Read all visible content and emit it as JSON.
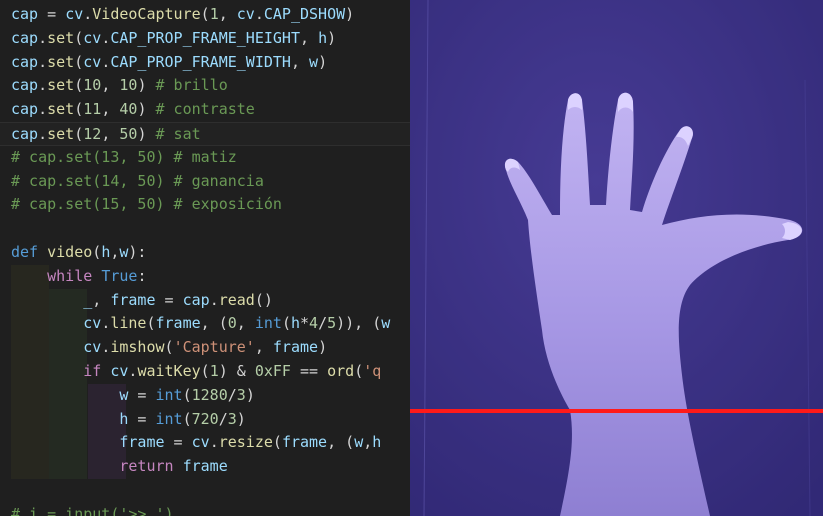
{
  "editor": {
    "lines": [
      [
        {
          "t": "cap",
          "c": "v"
        },
        {
          "t": " = ",
          "c": "p"
        },
        {
          "t": "cv",
          "c": "v"
        },
        {
          "t": ".",
          "c": "p"
        },
        {
          "t": "VideoCapture",
          "c": "f"
        },
        {
          "t": "(",
          "c": "p"
        },
        {
          "t": "1",
          "c": "n"
        },
        {
          "t": ", ",
          "c": "p"
        },
        {
          "t": "cv",
          "c": "v"
        },
        {
          "t": ".",
          "c": "p"
        },
        {
          "t": "CAP_DSHOW",
          "c": "v"
        },
        {
          "t": ")",
          "c": "p"
        }
      ],
      [
        {
          "t": "cap",
          "c": "v"
        },
        {
          "t": ".",
          "c": "p"
        },
        {
          "t": "set",
          "c": "f"
        },
        {
          "t": "(",
          "c": "p"
        },
        {
          "t": "cv",
          "c": "v"
        },
        {
          "t": ".",
          "c": "p"
        },
        {
          "t": "CAP_PROP_FRAME_HEIGHT",
          "c": "v"
        },
        {
          "t": ", ",
          "c": "p"
        },
        {
          "t": "h",
          "c": "v"
        },
        {
          "t": ")",
          "c": "p"
        }
      ],
      [
        {
          "t": "cap",
          "c": "v"
        },
        {
          "t": ".",
          "c": "p"
        },
        {
          "t": "set",
          "c": "f"
        },
        {
          "t": "(",
          "c": "p"
        },
        {
          "t": "cv",
          "c": "v"
        },
        {
          "t": ".",
          "c": "p"
        },
        {
          "t": "CAP_PROP_FRAME_WIDTH",
          "c": "v"
        },
        {
          "t": ", ",
          "c": "p"
        },
        {
          "t": "w",
          "c": "v"
        },
        {
          "t": ")",
          "c": "p"
        }
      ],
      [
        {
          "t": "cap",
          "c": "v"
        },
        {
          "t": ".",
          "c": "p"
        },
        {
          "t": "set",
          "c": "f"
        },
        {
          "t": "(",
          "c": "p"
        },
        {
          "t": "10",
          "c": "n"
        },
        {
          "t": ", ",
          "c": "p"
        },
        {
          "t": "10",
          "c": "n"
        },
        {
          "t": ") ",
          "c": "p"
        },
        {
          "t": "# brillo",
          "c": "c"
        }
      ],
      [
        {
          "t": "cap",
          "c": "v"
        },
        {
          "t": ".",
          "c": "p"
        },
        {
          "t": "set",
          "c": "f"
        },
        {
          "t": "(",
          "c": "p"
        },
        {
          "t": "11",
          "c": "n"
        },
        {
          "t": ", ",
          "c": "p"
        },
        {
          "t": "40",
          "c": "n"
        },
        {
          "t": ") ",
          "c": "p"
        },
        {
          "t": "# contraste",
          "c": "c"
        }
      ],
      [
        {
          "t": "cap",
          "c": "v"
        },
        {
          "t": ".",
          "c": "p"
        },
        {
          "t": "set",
          "c": "f"
        },
        {
          "t": "(",
          "c": "p"
        },
        {
          "t": "12",
          "c": "n"
        },
        {
          "t": ", ",
          "c": "p"
        },
        {
          "t": "50",
          "c": "n"
        },
        {
          "t": ") ",
          "c": "p"
        },
        {
          "t": "# sat",
          "c": "c"
        }
      ],
      [
        {
          "t": "# cap.set(13, 50) # matiz",
          "c": "c"
        }
      ],
      [
        {
          "t": "# cap.set(14, 50) # ganancia",
          "c": "c"
        }
      ],
      [
        {
          "t": "# cap.set(15, 50) # exposición",
          "c": "c"
        }
      ],
      [],
      [
        {
          "t": "def",
          "c": "kw"
        },
        {
          "t": " ",
          "c": "p"
        },
        {
          "t": "video",
          "c": "f"
        },
        {
          "t": "(",
          "c": "p"
        },
        {
          "t": "h",
          "c": "v"
        },
        {
          "t": ",",
          "c": "p"
        },
        {
          "t": "w",
          "c": "v"
        },
        {
          "t": "):",
          "c": "p"
        }
      ],
      [
        {
          "t": "    ",
          "c": "p"
        },
        {
          "t": "while",
          "c": "ck"
        },
        {
          "t": " ",
          "c": "p"
        },
        {
          "t": "True",
          "c": "kw"
        },
        {
          "t": ":",
          "c": "p"
        }
      ],
      [
        {
          "t": "        ",
          "c": "p"
        },
        {
          "t": "_",
          "c": "v"
        },
        {
          "t": ", ",
          "c": "p"
        },
        {
          "t": "frame",
          "c": "v"
        },
        {
          "t": " = ",
          "c": "p"
        },
        {
          "t": "cap",
          "c": "v"
        },
        {
          "t": ".",
          "c": "p"
        },
        {
          "t": "read",
          "c": "f"
        },
        {
          "t": "()",
          "c": "p"
        }
      ],
      [
        {
          "t": "        ",
          "c": "p"
        },
        {
          "t": "cv",
          "c": "v"
        },
        {
          "t": ".",
          "c": "p"
        },
        {
          "t": "line",
          "c": "f"
        },
        {
          "t": "(",
          "c": "p"
        },
        {
          "t": "frame",
          "c": "v"
        },
        {
          "t": ", (",
          "c": "p"
        },
        {
          "t": "0",
          "c": "n"
        },
        {
          "t": ", ",
          "c": "p"
        },
        {
          "t": "int",
          "c": "kw"
        },
        {
          "t": "(",
          "c": "p"
        },
        {
          "t": "h",
          "c": "v"
        },
        {
          "t": "*",
          "c": "p"
        },
        {
          "t": "4",
          "c": "n"
        },
        {
          "t": "/",
          "c": "p"
        },
        {
          "t": "5",
          "c": "n"
        },
        {
          "t": ")), (",
          "c": "p"
        },
        {
          "t": "w",
          "c": "v"
        }
      ],
      [
        {
          "t": "        ",
          "c": "p"
        },
        {
          "t": "cv",
          "c": "v"
        },
        {
          "t": ".",
          "c": "p"
        },
        {
          "t": "imshow",
          "c": "f"
        },
        {
          "t": "(",
          "c": "p"
        },
        {
          "t": "'Capture'",
          "c": "s"
        },
        {
          "t": ", ",
          "c": "p"
        },
        {
          "t": "frame",
          "c": "v"
        },
        {
          "t": ")",
          "c": "p"
        }
      ],
      [
        {
          "t": "        ",
          "c": "p"
        },
        {
          "t": "if",
          "c": "ck"
        },
        {
          "t": " ",
          "c": "p"
        },
        {
          "t": "cv",
          "c": "v"
        },
        {
          "t": ".",
          "c": "p"
        },
        {
          "t": "waitKey",
          "c": "f"
        },
        {
          "t": "(",
          "c": "p"
        },
        {
          "t": "1",
          "c": "n"
        },
        {
          "t": ") & ",
          "c": "p"
        },
        {
          "t": "0xFF",
          "c": "n"
        },
        {
          "t": " == ",
          "c": "p"
        },
        {
          "t": "ord",
          "c": "f"
        },
        {
          "t": "(",
          "c": "p"
        },
        {
          "t": "'q",
          "c": "s"
        }
      ],
      [
        {
          "t": "            ",
          "c": "p"
        },
        {
          "t": "w",
          "c": "v"
        },
        {
          "t": " = ",
          "c": "p"
        },
        {
          "t": "int",
          "c": "kw"
        },
        {
          "t": "(",
          "c": "p"
        },
        {
          "t": "1280",
          "c": "n"
        },
        {
          "t": "/",
          "c": "p"
        },
        {
          "t": "3",
          "c": "n"
        },
        {
          "t": ")",
          "c": "p"
        }
      ],
      [
        {
          "t": "            ",
          "c": "p"
        },
        {
          "t": "h",
          "c": "v"
        },
        {
          "t": " = ",
          "c": "p"
        },
        {
          "t": "int",
          "c": "kw"
        },
        {
          "t": "(",
          "c": "p"
        },
        {
          "t": "720",
          "c": "n"
        },
        {
          "t": "/",
          "c": "p"
        },
        {
          "t": "3",
          "c": "n"
        },
        {
          "t": ")",
          "c": "p"
        }
      ],
      [
        {
          "t": "            ",
          "c": "p"
        },
        {
          "t": "frame",
          "c": "v"
        },
        {
          "t": " = ",
          "c": "p"
        },
        {
          "t": "cv",
          "c": "v"
        },
        {
          "t": ".",
          "c": "p"
        },
        {
          "t": "resize",
          "c": "f"
        },
        {
          "t": "(",
          "c": "p"
        },
        {
          "t": "frame",
          "c": "v"
        },
        {
          "t": ", (",
          "c": "p"
        },
        {
          "t": "w",
          "c": "v"
        },
        {
          "t": ",",
          "c": "p"
        },
        {
          "t": "h",
          "c": "v"
        }
      ],
      [
        {
          "t": "            ",
          "c": "p"
        },
        {
          "t": "return",
          "c": "ck"
        },
        {
          "t": " ",
          "c": "p"
        },
        {
          "t": "frame",
          "c": "v"
        }
      ],
      [],
      [
        {
          "t": "# i = input('>> ')",
          "c": "c"
        }
      ]
    ]
  },
  "camera": {
    "icon": "hand-image",
    "line_color": "#ff1a1a",
    "line_position_fraction": 0.8
  }
}
